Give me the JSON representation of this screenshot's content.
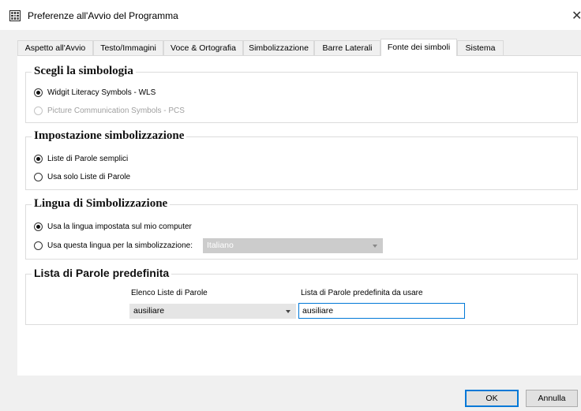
{
  "window": {
    "title": "Preferenze all'Avvio del Programma"
  },
  "tabs": [
    {
      "label": "Aspetto all'Avvio",
      "active": false
    },
    {
      "label": "Testo/Immagini",
      "active": false
    },
    {
      "label": "Voce & Ortografia",
      "active": false
    },
    {
      "label": "Simbolizzazione",
      "active": false
    },
    {
      "label": "Barre Laterali",
      "active": false
    },
    {
      "label": "Fonte dei simboli",
      "active": true
    },
    {
      "label": "Sistema",
      "active": false
    }
  ],
  "symbol_set": {
    "title": "Scegli la simbologia",
    "options": [
      {
        "label": "Widgit Literacy Symbols - WLS",
        "checked": true,
        "disabled": false
      },
      {
        "label": "Picture Communication Symbols - PCS",
        "checked": false,
        "disabled": true
      }
    ]
  },
  "symbolization_setup": {
    "title": "Impostazione simbolizzazione",
    "options": [
      {
        "label": "Liste di Parole semplici",
        "checked": true
      },
      {
        "label": "Usa solo Liste di Parole",
        "checked": false
      }
    ]
  },
  "language": {
    "title": "Lingua di Simbolizzazione",
    "options": [
      {
        "label": "Usa la lingua impostata sul mio computer",
        "checked": true
      },
      {
        "label": "Usa questa lingua per la simbolizzazione:",
        "checked": false
      }
    ],
    "select_value": "Italiano"
  },
  "default_wordlist": {
    "title": "Lista di Parole predefinita",
    "list_label": "Elenco Liste di Parole",
    "list_value": "ausiliare",
    "default_label": "Lista di Parole predefinita da usare",
    "default_value": "ausiliare"
  },
  "buttons": {
    "ok": "OK",
    "cancel": "Annulla"
  }
}
